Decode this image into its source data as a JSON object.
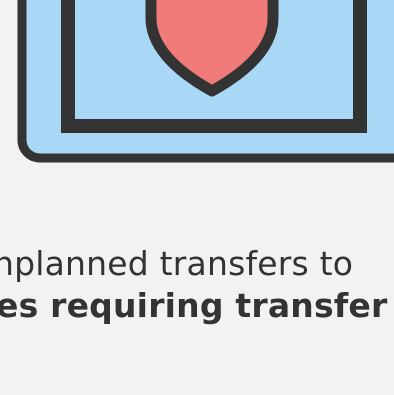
{
  "colors": {
    "background": "#f2f2f2",
    "outline": "#333333",
    "panel_fill": "#a8d8f5",
    "shield_fill": "#f17b78",
    "text": "#333333"
  },
  "illustration": {
    "icon_name": "shield-icon"
  },
  "text": {
    "line_1": "nplanned transfers to",
    "line_2": "es requiring transfer to"
  }
}
